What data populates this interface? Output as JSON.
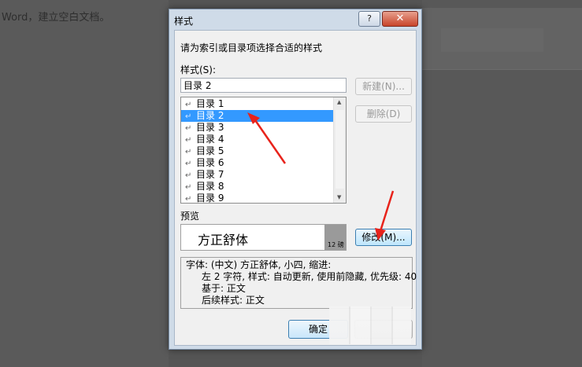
{
  "background": {
    "doc_text": "Word，建立空白文档。"
  },
  "dialog": {
    "title": "样式",
    "help_label": "?",
    "close_label": "✕",
    "instruction": "请为索引或目录项选择合适的样式",
    "styles_label": "样式(S):",
    "style_value": "目录 2",
    "style_items": [
      {
        "label": "目录 1"
      },
      {
        "label": "目录 2",
        "selected": true
      },
      {
        "label": "目录 3"
      },
      {
        "label": "目录 4"
      },
      {
        "label": "目录 5"
      },
      {
        "label": "目录 6"
      },
      {
        "label": "目录 7"
      },
      {
        "label": "目录 8"
      },
      {
        "label": "目录 9"
      }
    ],
    "new_button": "新建(N)...",
    "delete_button": "删除(D)",
    "preview_label": "预览",
    "preview_font": "方正舒体",
    "preview_size": "12 磅",
    "modify_button": "修改(M)...",
    "description": {
      "line1": "字体: (中文) 方正舒体, 小四, 缩进:",
      "line2": "左  2 字符, 样式: 自动更新, 使用前隐藏, 优先级: 40",
      "line3": "基于: 正文",
      "line4": "后续样式: 正文"
    },
    "ok_button": "确定"
  },
  "annotations": {
    "arrow_color": "#e8231b"
  }
}
